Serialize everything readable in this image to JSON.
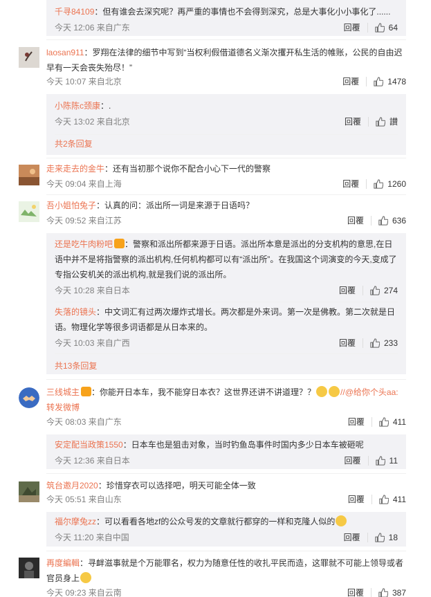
{
  "actions": {
    "reply_label": "回覆"
  },
  "c0": {
    "sub": {
      "name": "千寻84109",
      "text": "但有谁会去深究呢？再严重的事情也不会得到深究，总是大事化小小事化了......",
      "time": "今天 12:06 来自广东",
      "likes": "64"
    }
  },
  "c1": {
    "name": "laosan911",
    "text": "罗翔在法律的细节中写到“当权利假借道德名义渐次攫开私生活的帷账，公民的自由迟早有一天会丧失殆尽！”",
    "time": "今天 10:07 来自北京",
    "likes": "1478",
    "sub": {
      "name": "小陈陈c颈康",
      "text": ".",
      "time": "今天 13:02 来自北京",
      "likes": "讃"
    },
    "more": "共2条回复"
  },
  "c2": {
    "name": "走来走去的金牛",
    "text": "还有当初那个说你不配合小心下一代的警察",
    "time": "今天 09:04 来自上海",
    "likes": "1260"
  },
  "c3": {
    "name": "吾小姐怕兔子",
    "text": "认真的问：派出所一词是来源于日语吗？",
    "time": "今天 09:52 来自江苏",
    "likes": "636",
    "sub1": {
      "name": "还是吃牛肉粉吧",
      "text": "警察和派出所都来源于日语。派出所本意是派出的分支机构的意思,在日语中并不是将指警察的派出机构,任何机构都可以有“派出所”。在我国这个词演变的今天,变成了专指公安机关的派出机构,就是我们说的派出所。",
      "time": "今天 10:28 来自日本",
      "likes": "274"
    },
    "sub2": {
      "name": "失落的镜头",
      "text": "中文词汇有过两次爆炸式增长。两次都是外来词。第一次是佛教。第二次就是日语。物理化学等很多词语都是从日本来的。",
      "time": "今天 10:03 来自广西",
      "likes": "233"
    },
    "more": "共13条回复"
  },
  "c4": {
    "name": "三线城主",
    "text": "你能开日本车，我不能穿日本衣？这世界还讲不讲道理？？",
    "repost": "//@给你个头aa:转发微博",
    "time": "今天 08:03 来自广东",
    "likes": "411",
    "sub": {
      "name": "安定配当政策1550",
      "text": "日本车也是狙击对象，当时钓鱼岛事件时国内多少日本车被砸呢",
      "time": "今天 12:36 来自日本",
      "likes": "11"
    }
  },
  "c5": {
    "name": "筑台邀月2020",
    "text": "珍惜穿衣可以选择吧，明天可能全体一致",
    "time": "今天 05:51 来自山东",
    "likes": "411",
    "sub": {
      "name": "福尔摩兔zz",
      "text": "可以看看各地zf的公众号发的文章就行都穿的一样和克隆人似的",
      "time": "今天 11:20 来自中国",
      "likes": "18"
    }
  },
  "c6": {
    "name": "再度編輯",
    "text": "寻衅滋事就是个万能罪名，权力为随意任性的收扎平民而造，这罪就不可能上领导或者官员身上",
    "time": "今天 09:23 来自云南",
    "likes": "387"
  }
}
